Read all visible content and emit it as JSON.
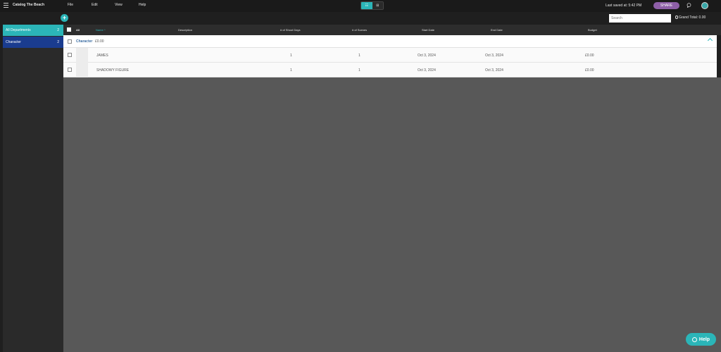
{
  "app": {
    "title": "Catalog The Beach",
    "menus": [
      "File",
      "Edit",
      "View",
      "Help"
    ],
    "view_toggle": [
      "☷",
      "⊞"
    ],
    "last_saved": "Last saved at: 5:42 PM",
    "share_label": "SHARE"
  },
  "toolbar": {
    "add_label": "+",
    "search_placeholder": "Search",
    "grand_total": "Grand Total: 0.00"
  },
  "sidebar": {
    "items": [
      {
        "label": "All Departments",
        "count": "2"
      },
      {
        "label": "Character",
        "count": "2"
      }
    ]
  },
  "table": {
    "headers": {
      "all": "All",
      "name": "Name ^",
      "description": "Description",
      "shoot_days": "# of Shoot Days",
      "scenes": "# of Scenes",
      "start_date": "Start Date",
      "end_date": "End Date",
      "budget": "Budget"
    },
    "group": {
      "name": "Character",
      "amount": "£0.00"
    },
    "rows": [
      {
        "name": "JAMES",
        "shoot_days": "1",
        "scenes": "1",
        "start": "Oct 3, 2024",
        "end": "Oct 3, 2024",
        "budget": "£0.00"
      },
      {
        "name": "SHADOWY FIGURE",
        "shoot_days": "1",
        "scenes": "1",
        "start": "Oct 3, 2024",
        "end": "Oct 3, 2024",
        "budget": "£0.00"
      }
    ]
  },
  "help": {
    "label": "Help"
  },
  "colors": {
    "accent": "#2bb5b8",
    "selected": "#1a3c8f",
    "share": "#8e5fa8"
  }
}
